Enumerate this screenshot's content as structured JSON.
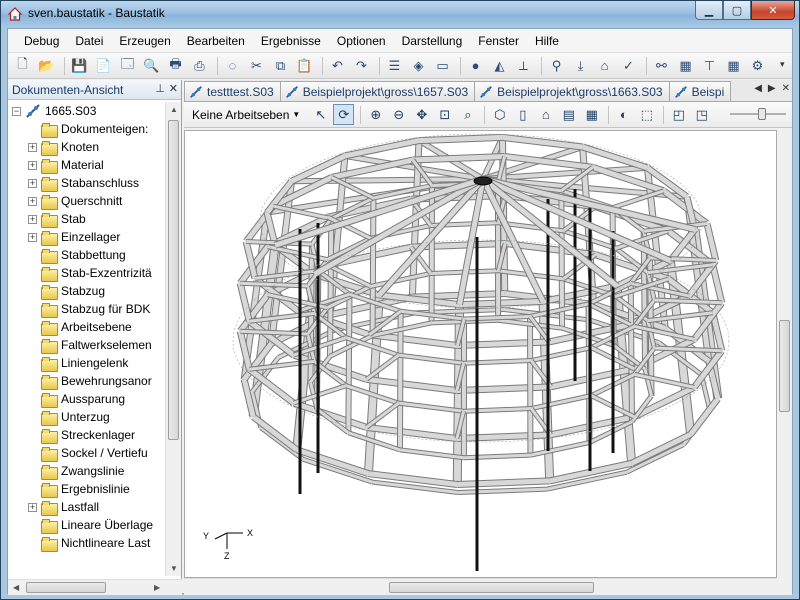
{
  "window": {
    "title": "sven.baustatik - Baustatik"
  },
  "menubar": {
    "items": [
      "Debug",
      "Datei",
      "Erzeugen",
      "Bearbeiten",
      "Ergebnisse",
      "Optionen",
      "Darstellung",
      "Fenster",
      "Hilfe"
    ]
  },
  "toolbar": {
    "icons": [
      "new-icon",
      "open-icon",
      "save-icon",
      "document-icon",
      "preview-icon",
      "print-preview-icon",
      "print-icon",
      "export-icon",
      "lasso-icon",
      "cut-icon",
      "copy-icon",
      "paste-icon",
      "undo-icon",
      "redo-icon",
      "properties-icon",
      "cube-view-icon",
      "monitor-icon",
      "sphere-icon",
      "perspective-icon",
      "axis-icon",
      "node-icon",
      "load-icon",
      "model-icon",
      "check-icon",
      "link-icon",
      "render-icon",
      "beam-icon",
      "grid-icon",
      "settings-icon"
    ]
  },
  "left_panel": {
    "title": "Dokumenten-Ansicht",
    "tree": {
      "root": "1665.S03",
      "items": [
        {
          "label": "Dokumenteigen:",
          "expandable": false
        },
        {
          "label": "Knoten",
          "expandable": true
        },
        {
          "label": "Material",
          "expandable": true
        },
        {
          "label": "Stabanschluss",
          "expandable": true
        },
        {
          "label": "Querschnitt",
          "expandable": true
        },
        {
          "label": "Stab",
          "expandable": true
        },
        {
          "label": "Einzellager",
          "expandable": true
        },
        {
          "label": "Stabbettung",
          "expandable": false
        },
        {
          "label": "Stab-Exzentrizitä",
          "expandable": false
        },
        {
          "label": "Stabzug",
          "expandable": false
        },
        {
          "label": "Stabzug für BDK",
          "expandable": false
        },
        {
          "label": "Arbeitsebene",
          "expandable": false
        },
        {
          "label": "Faltwerkselemen",
          "expandable": false
        },
        {
          "label": "Liniengelenk",
          "expandable": false
        },
        {
          "label": "Bewehrungsanor",
          "expandable": false
        },
        {
          "label": "Aussparung",
          "expandable": false
        },
        {
          "label": "Unterzug",
          "expandable": false
        },
        {
          "label": "Streckenlager",
          "expandable": false
        },
        {
          "label": "Sockel / Vertiefu",
          "expandable": false
        },
        {
          "label": "Zwangslinie",
          "expandable": false
        },
        {
          "label": "Ergebnislinie",
          "expandable": false
        },
        {
          "label": "Lastfall",
          "expandable": true
        },
        {
          "label": "Lineare Überlage",
          "expandable": false
        },
        {
          "label": "Nichtlineare Last",
          "expandable": false
        }
      ]
    }
  },
  "tabs": [
    {
      "label": "testttest.S03",
      "active": false
    },
    {
      "label": "Beispielprojekt\\gross\\1657.S03",
      "active": false
    },
    {
      "label": "Beispielprojekt\\gross\\1663.S03",
      "active": false
    },
    {
      "label": "Beispi",
      "active": false
    }
  ],
  "view_toolbar": {
    "workplane_label": "Keine Arbeitseben",
    "icons": [
      "pointer-icon",
      "rotate-icon",
      "zoom-in-icon",
      "zoom-out-icon",
      "pan-icon",
      "zoom-window-icon",
      "zoom-all-icon",
      "box-icon",
      "frame-icon",
      "house-icon",
      "wall-icon",
      "grid-icon",
      "shade-icon",
      "wireframe-icon",
      "cube-front-icon",
      "cube-side-icon"
    ]
  },
  "viewport": {
    "axis_labels": {
      "y": "Y",
      "x": "X",
      "z": "Z"
    }
  },
  "colors": {
    "titlebar": "#9cc1e1",
    "structure_fill": "#d8d8d8",
    "structure_edge": "#7a7a7a",
    "column_dark": "#111111"
  }
}
